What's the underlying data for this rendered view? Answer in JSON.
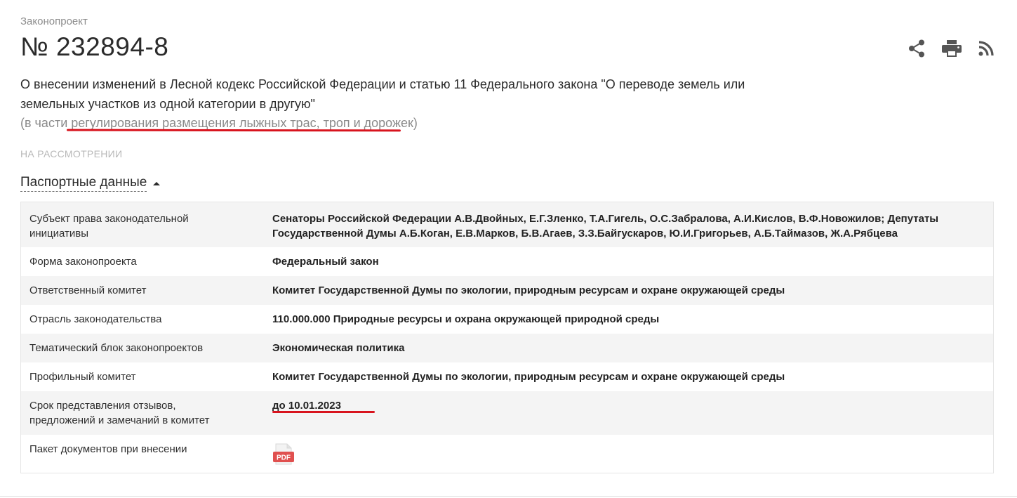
{
  "header": {
    "kind": "Законопроект",
    "number": "№ 232894-8"
  },
  "actions": {
    "share_icon": "share-icon",
    "print_icon": "print-icon",
    "rss_icon": "rss-icon"
  },
  "bill": {
    "title_line1": "О внесении изменений в Лесной кодекс Российской Федерации и статью 11 Федерального закона \"О переводе земель или",
    "title_line2": "земельных участков из одной категории в другую\"",
    "note_prefix": "(в части ",
    "note_highlight": "регулирования размещения лыжных трас, троп и дорожек)",
    "status": "НА РАССМОТРЕНИИ"
  },
  "passport": {
    "toggle_label": "Паспортные данные",
    "rows": [
      {
        "key": "Субъект права законодательной инициативы",
        "value": "Сенаторы Российской Федерации А.В.Двойных, Е.Г.Зленко, Т.А.Гигель, О.С.Забралова, А.И.Кислов, В.Ф.Новожилов; Депутаты Государственной Думы А.Б.Коган, Е.В.Марков, Б.В.Агаев, З.З.Байгускаров, Ю.И.Григорьев, А.Б.Таймазов, Ж.А.Рябцева"
      },
      {
        "key": "Форма законопроекта",
        "value": "Федеральный закон"
      },
      {
        "key": "Ответственный комитет",
        "value": "Комитет Государственной Думы по экологии, природным ресурсам и охране окружающей среды"
      },
      {
        "key": "Отрасль законодательства",
        "value": "110.000.000 Природные ресурсы и охрана окружающей природной среды"
      },
      {
        "key": "Тематический блок законопроектов",
        "value": "Экономическая политика"
      },
      {
        "key": "Профильный комитет",
        "value": "Комитет Государственной Думы по экологии, природным ресурсам и охране окружающей среды"
      },
      {
        "key": "Срок представления отзывов, предложений и замечаний в комитет",
        "value": "до 10.01.2023"
      },
      {
        "key": "Пакет документов при внесении",
        "pdf_label": "PDF"
      }
    ]
  },
  "colors": {
    "highlight_underline": "#d8141e",
    "pdf_red": "#e0504f"
  }
}
